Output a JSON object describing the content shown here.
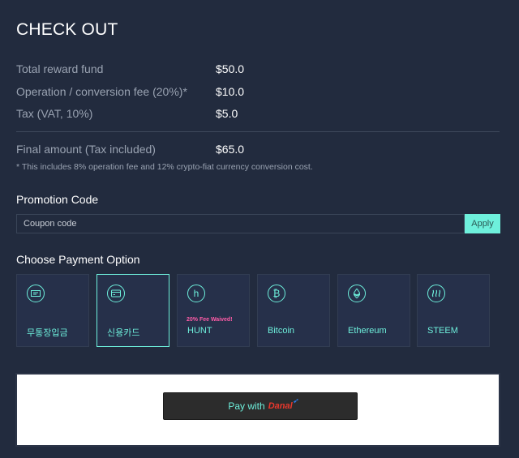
{
  "page": {
    "title": "CHECK OUT"
  },
  "summary": {
    "rows": [
      {
        "label": "Total reward fund",
        "value": "$50.0"
      },
      {
        "label": "Operation / conversion fee (20%)*",
        "value": "$10.0"
      },
      {
        "label": "Tax (VAT, 10%)",
        "value": "$5.0"
      }
    ],
    "final": {
      "label": "Final amount (Tax included)",
      "value": "$65.0"
    },
    "note": "* This includes 8% operation fee and 12% crypto-fiat currency conversion cost."
  },
  "promotion": {
    "heading": "Promotion Code",
    "placeholder": "Coupon code",
    "apply_label": "Apply"
  },
  "payment": {
    "heading": "Choose Payment Option",
    "options": [
      {
        "label": "무통장입금",
        "icon": "bank-transfer-icon",
        "selected": false
      },
      {
        "label": "신용카드",
        "icon": "credit-card-icon",
        "selected": true
      },
      {
        "label": "HUNT",
        "icon": "hunt-icon",
        "badge": "20% Fee Waived!",
        "selected": false
      },
      {
        "label": "Bitcoin",
        "icon": "bitcoin-icon",
        "selected": false
      },
      {
        "label": "Ethereum",
        "icon": "ethereum-icon",
        "selected": false
      },
      {
        "label": "STEEM",
        "icon": "steem-icon",
        "selected": false
      }
    ],
    "button": {
      "prefix": "Pay with",
      "brand": "Danal"
    }
  },
  "colors": {
    "background": "#222b3e",
    "accent": "#6ef0dc",
    "badge": "#ff5ca8",
    "muted_text": "#9aa3b2"
  }
}
